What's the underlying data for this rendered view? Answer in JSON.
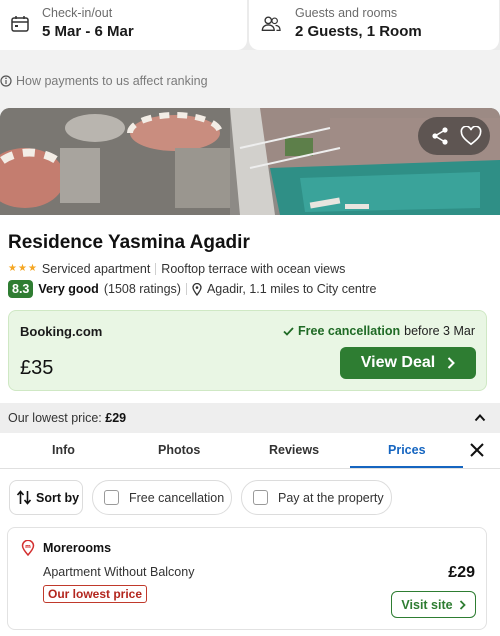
{
  "search": {
    "checkin_label": "Check-in/out",
    "checkin_value": "5 Mar - 6 Mar",
    "guests_label": "Guests and rooms",
    "guests_value": "2 Guests, 1 Room"
  },
  "ranking_text": "How payments to us affect ranking",
  "hotel": {
    "name": "Residence Yasmina Agadir",
    "stars": 3,
    "type": "Serviced apartment",
    "feature": "Rooftop terrace with ocean views",
    "score": "8.3",
    "rating_word": "Very good",
    "ratings_count": "(1508 ratings)",
    "location": "Agadir, 1.1 miles to City centre"
  },
  "deal": {
    "site": "Booking.com",
    "free_cancellation": "Free cancellation",
    "cancellation_date": "before 3 Mar",
    "price": "£35",
    "button": "View Deal"
  },
  "lowest_bar": {
    "label": "Our lowest price:",
    "price": "£29"
  },
  "tabs": [
    {
      "label": "Info"
    },
    {
      "label": "Photos"
    },
    {
      "label": "Reviews"
    },
    {
      "label": "Prices"
    }
  ],
  "active_tab": "Prices",
  "filters": {
    "sort": "Sort by",
    "free_cancellation": "Free cancellation",
    "pay_at_property": "Pay at the property"
  },
  "offer": {
    "provider": "Morerooms",
    "room": "Apartment Without Balcony",
    "badge": "Our lowest price",
    "price": "£29",
    "button": "Visit site"
  },
  "colors": {
    "accent_green": "#2e7d32",
    "tab_blue": "#1565c0",
    "deal_bg": "#e9f6e4",
    "badge_red": "#b3261e",
    "star": "#f5a623"
  }
}
